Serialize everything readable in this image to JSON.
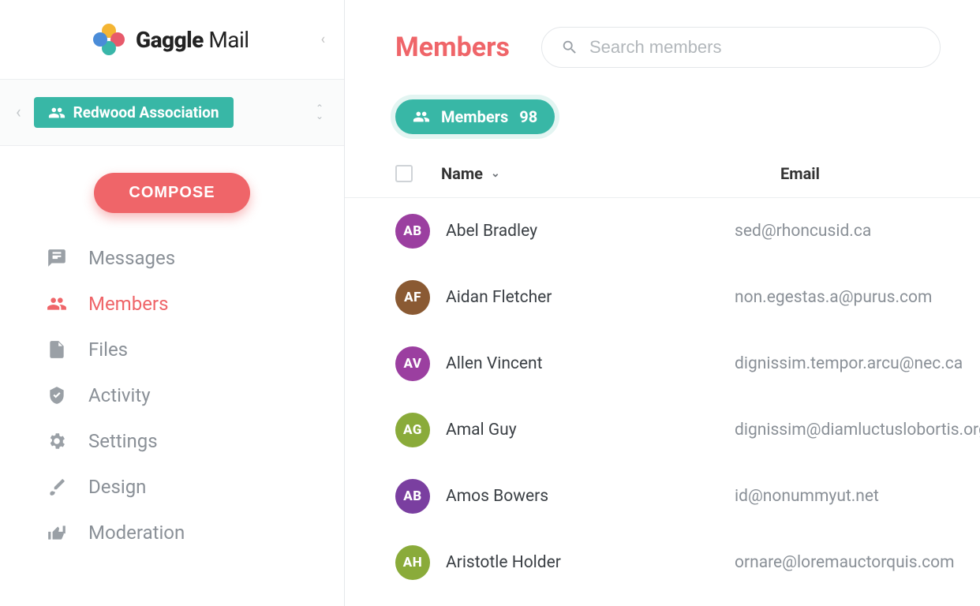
{
  "brand": {
    "bold": "Gaggle",
    "light": " Mail"
  },
  "group": {
    "name": "Redwood Association"
  },
  "compose_label": "COMPOSE",
  "nav": [
    {
      "key": "messages",
      "label": "Messages",
      "icon": "message",
      "active": false
    },
    {
      "key": "members",
      "label": "Members",
      "icon": "people",
      "active": true
    },
    {
      "key": "files",
      "label": "Files",
      "icon": "file",
      "active": false
    },
    {
      "key": "activity",
      "label": "Activity",
      "icon": "shield",
      "active": false
    },
    {
      "key": "settings",
      "label": "Settings",
      "icon": "gear",
      "active": false
    },
    {
      "key": "design",
      "label": "Design",
      "icon": "brush",
      "active": false
    },
    {
      "key": "moderation",
      "label": "Moderation",
      "icon": "thumbs",
      "active": false
    }
  ],
  "page_title": "Members",
  "search": {
    "placeholder": "Search members"
  },
  "filter": {
    "label": "Members",
    "count": "98"
  },
  "columns": {
    "name": "Name",
    "email": "Email"
  },
  "members": [
    {
      "initials": "AB",
      "name": "Abel Bradley",
      "email": "sed@rhoncusid.ca",
      "color": "#9b3fa0"
    },
    {
      "initials": "AF",
      "name": "Aidan Fletcher",
      "email": "non.egestas.a@purus.com",
      "color": "#8a5a33"
    },
    {
      "initials": "AV",
      "name": "Allen Vincent",
      "email": "dignissim.tempor.arcu@nec.ca",
      "color": "#9b3fa0"
    },
    {
      "initials": "AG",
      "name": "Amal Guy",
      "email": "dignissim@diamluctuslobortis.org",
      "color": "#8aab3a"
    },
    {
      "initials": "AB",
      "name": "Amos Bowers",
      "email": "id@nonummyut.net",
      "color": "#7a3fa0"
    },
    {
      "initials": "AH",
      "name": "Aristotle Holder",
      "email": "ornare@loremauctorquis.com",
      "color": "#8aab3a"
    }
  ]
}
